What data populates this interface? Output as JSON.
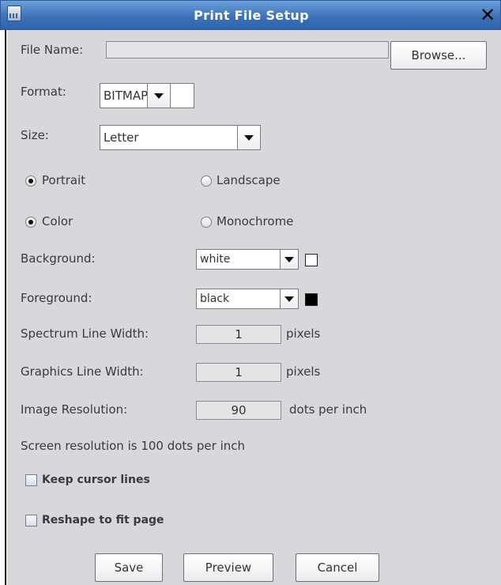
{
  "window": {
    "title": "Print File Setup",
    "close_glyph": "✕",
    "icon": "app-icon"
  },
  "file": {
    "label": "File Name:",
    "value": "",
    "browse_label": "Browse..."
  },
  "format": {
    "label": "Format:",
    "selected": "BITMAP"
  },
  "size": {
    "label": "Size:",
    "selected": "Letter"
  },
  "orientation": {
    "portrait_label": "Portrait",
    "landscape_label": "Landscape",
    "selected": "Portrait"
  },
  "color_mode": {
    "color_label": "Color",
    "monochrome_label": "Monochrome",
    "selected": "Color"
  },
  "background": {
    "label": "Background:",
    "selected": "white",
    "swatch_color": "#ffffff"
  },
  "foreground": {
    "label": "Foreground:",
    "selected": "black",
    "swatch_color": "#000000"
  },
  "spectrum_line_width": {
    "label": "Spectrum Line Width:",
    "value": "1",
    "unit": "pixels"
  },
  "graphics_line_width": {
    "label": "Graphics Line Width:",
    "value": "1",
    "unit": "pixels"
  },
  "image_resolution": {
    "label": "Image Resolution:",
    "value": "90",
    "unit": "dots per inch"
  },
  "screen_resolution_text": "Screen resolution is 100 dots per inch",
  "options": {
    "keep_cursor_lines": {
      "label": "Keep cursor lines",
      "checked": false
    },
    "reshape_to_fit": {
      "label": "Reshape to fit page",
      "checked": false
    }
  },
  "actions": {
    "save_label": "Save",
    "preview_label": "Preview",
    "cancel_label": "Cancel"
  },
  "colors": {
    "titlebar": "#3d72b8",
    "panel": "#d8d8dc"
  }
}
